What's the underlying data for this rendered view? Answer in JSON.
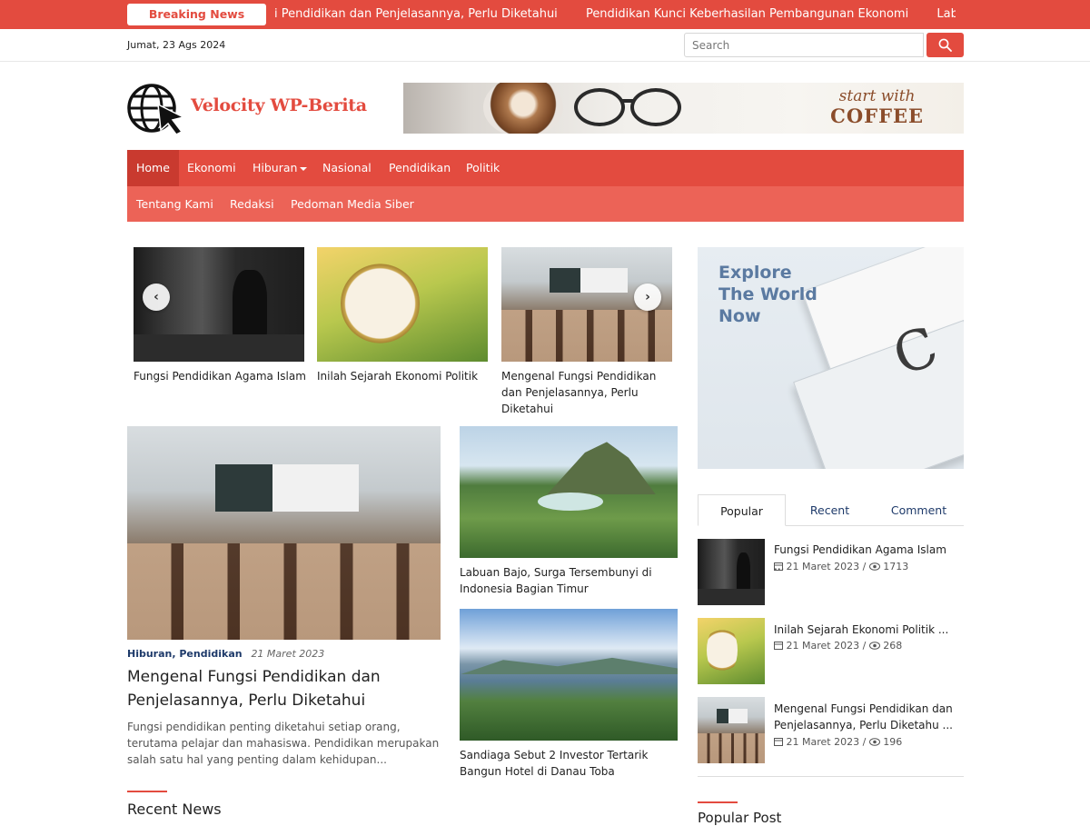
{
  "breaking": {
    "badge": "Breaking News",
    "items": [
      "i Pendidikan dan Penjelasannya, Perlu Diketahui",
      "Pendidikan Kunci Keberhasilan Pembangunan Ekonomi",
      "Labuan Bajo, Surga Tersembunyi di Indonesia Bagian Timur"
    ]
  },
  "header": {
    "date": "Jumat, 23 Ags 2024",
    "search_placeholder": "Search"
  },
  "brand": {
    "logo_text": "Velocity WP-Berita",
    "banner_small": "start with",
    "banner_big": "COFFEE"
  },
  "nav": {
    "row1": [
      "Home",
      "Ekonomi",
      "Hiburan",
      "Nasional",
      "Pendidikan",
      "Politik"
    ],
    "row2": [
      "Tentang Kami",
      "Redaksi",
      "Pedoman Media Siber"
    ]
  },
  "slider": [
    {
      "title": "Fungsi Pendidikan Agama Islam"
    },
    {
      "title": "Inilah Sejarah Ekonomi Politik"
    },
    {
      "title": "Mengenal Fungsi Pendidikan dan Penjelasannya, Perlu Diketahui"
    }
  ],
  "featured": {
    "categories": "Hiburan, Pendidikan",
    "date": "21 Maret 2023",
    "title": "Mengenal Fungsi Pendidikan dan Penjelasannya, Perlu Diketahui",
    "excerpt": "Fungsi pendidikan penting diketahui setiap orang, terutama pelajar dan mahasiswa. Pendidikan merupakan salah satu hal yang penting dalam kehidupan..."
  },
  "side_posts": [
    {
      "title": "Labuan Bajo, Surga Tersembunyi di Indonesia Bagian Timur"
    },
    {
      "title": "Sandiaga Sebut 2 Investor Tertarik Bangun Hotel di Danau Toba"
    }
  ],
  "ad": {
    "text": "Explore The World Now"
  },
  "tabs": [
    "Popular",
    "Recent",
    "Comment"
  ],
  "popular": [
    {
      "title": "Fungsi Pendidikan Agama Islam ...",
      "date": "21 Maret 2023",
      "views": "1713"
    },
    {
      "title": "Inilah Sejarah Ekonomi Politik ...",
      "date": "21 Maret 2023",
      "views": "268"
    },
    {
      "title": "Mengenal Fungsi Pendidikan dan Penjelasannya, Perlu Diketahu ...",
      "date": "21 Maret 2023",
      "views": "196"
    }
  ],
  "sections": {
    "recent_news": "Recent News",
    "popular_post": "Popular Post"
  },
  "colors": {
    "accent": "#e34b3f",
    "nav_secondary": "#ec6357",
    "link_blue": "#1e3a6a"
  }
}
